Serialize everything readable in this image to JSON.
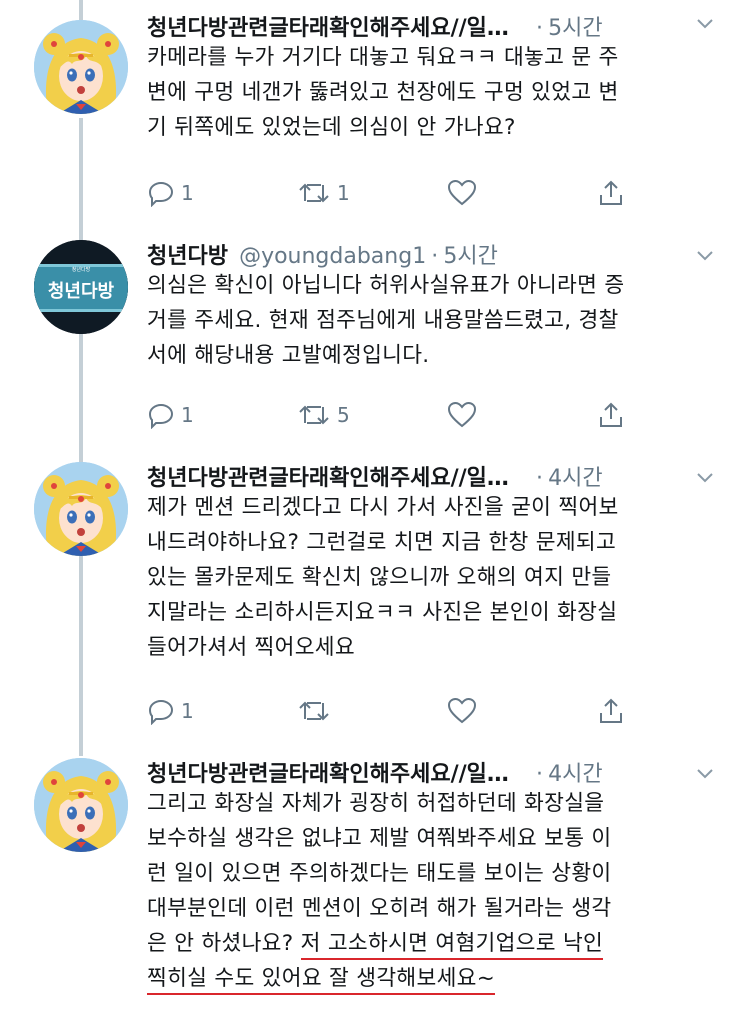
{
  "tweets": [
    {
      "name": "청년다방관련글타래확인해주세요//일…",
      "handle": "",
      "time": "5시간",
      "avatar": "sailor-moon-avatar",
      "lines": [
        "카메라를 누가 거기다 대놓고 둬요ㅋㅋ 대놓고 문 주",
        "변에 구멍 네갠가 뚫려있고 천장에도 구멍 있었고 변",
        "기 뒤쪽에도 있었는데 의심이 안 가나요?"
      ],
      "replies": "1",
      "retweets": "1",
      "likes": ""
    },
    {
      "name": "청년다방",
      "handle": "@youngdabang1",
      "time": "5시간",
      "avatar": "youngdabang-logo-avatar",
      "avatar_text": "청년다방",
      "avatar_small": "청년다방",
      "lines": [
        "의심은 확신이 아닙니다 허위사실유표가 아니라면 증",
        "거를 주세요. 현재 점주님에게 내용말씀드렸고, 경찰",
        "서에 해당내용 고발예정입니다."
      ],
      "replies": "1",
      "retweets": "5",
      "likes": ""
    },
    {
      "name": "청년다방관련글타래확인해주세요//일…",
      "handle": "",
      "time": "4시간",
      "avatar": "sailor-moon-avatar",
      "lines": [
        "제가 멘션 드리겠다고 다시 가서 사진을 굳이 찍어보",
        "내드려야하나요? 그런걸로 치면 지금 한창 문제되고",
        "있는 몰카문제도 확신치 않으니까 오해의 여지 만들",
        "지말라는 소리하시든지요ㅋㅋ 사진은 본인이 화장실",
        "들어가셔서 찍어오세요"
      ],
      "replies": "1",
      "retweets": "",
      "likes": ""
    },
    {
      "name": "청년다방관련글타래확인해주세요//일…",
      "handle": "",
      "time": "4시간",
      "avatar": "sailor-moon-avatar",
      "lines": [
        "그리고 화장실 자체가 굉장히 허접하던데 화장실을",
        "보수하실 생각은 없냐고 제발 여쭤봐주세요 보통 이",
        "런 일이 있으면 주의하겠다는 태도를 보이는 상황이",
        "대부분인데 이런 멘션이 오히려 해가 될거라는 생각"
      ],
      "line5_plain": "은 안 하셨나요? ",
      "line5_underlined": "저  고소하시면 여혐기업으로 낙인",
      "line6_underlined": "찍히실 수도 있어요 잘 생각해보세요~"
    }
  ],
  "colors": {
    "text": "#14171a",
    "secondary": "#657786",
    "thread_line": "#c4cfd6",
    "underline": "#d9262c"
  }
}
